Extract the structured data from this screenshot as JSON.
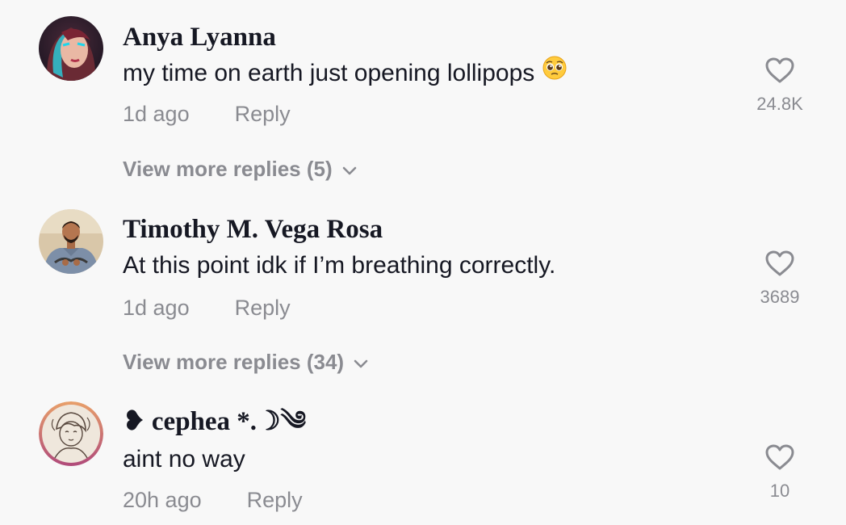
{
  "comments": [
    {
      "username": "Anya Lyanna",
      "text": "my time on earth just opening lollipops",
      "emoji": "pleading-face-emoji",
      "time": "1d ago",
      "reply_label": "Reply",
      "likes": "24.8K",
      "view_more": "View more replies (5)"
    },
    {
      "username": "Timothy M. Vega Rosa",
      "text": "At this point idk if I’m breathing correctly.",
      "time": "1d ago",
      "reply_label": "Reply",
      "likes": "3689",
      "view_more": "View more replies (34)"
    },
    {
      "username": "❥ cephea *.☽༄",
      "text": "aint no way",
      "time": "20h ago",
      "reply_label": "Reply",
      "likes": "10"
    }
  ],
  "colors": {
    "background": "#f8f8f8",
    "primary_text": "#161823",
    "secondary_text": "#8a8b91"
  },
  "icons": {
    "like": "heart-outline-icon",
    "expand": "chevron-down-icon"
  }
}
